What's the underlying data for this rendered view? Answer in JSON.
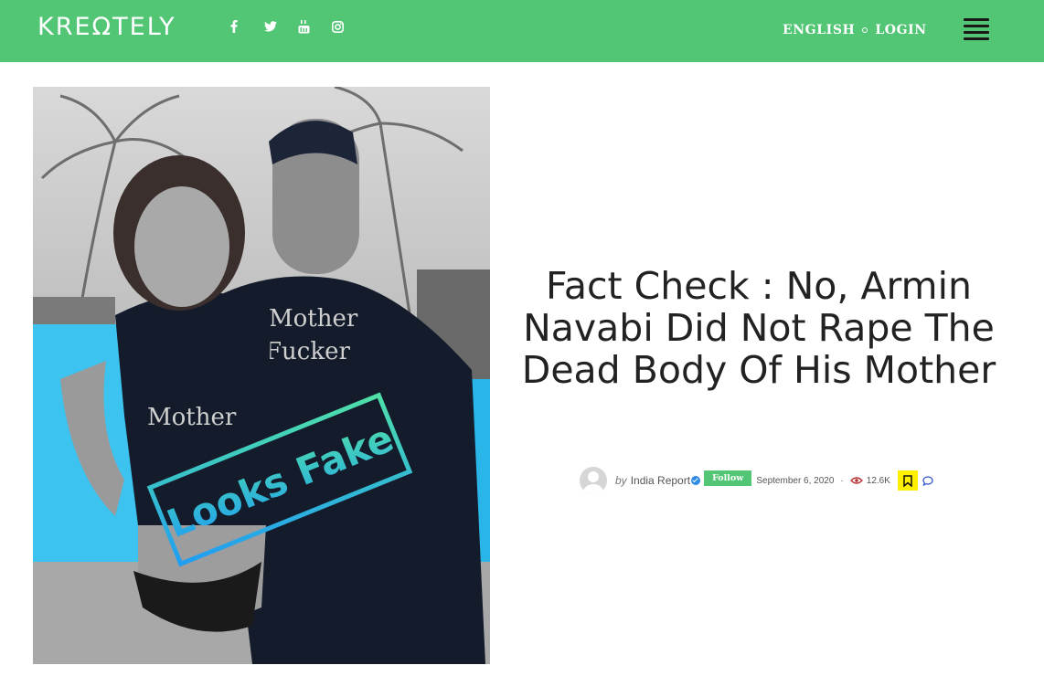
{
  "header": {
    "logo": "KREΩTELY",
    "social_icons": [
      "facebook-icon",
      "twitter-icon",
      "youtube-icon",
      "instagram-icon"
    ],
    "language_label": "ENGLISH",
    "login_label": "LOGIN",
    "menu_icon": "hamburger-menu-icon",
    "background_color": "#52c675"
  },
  "hero": {
    "left_shirt_text": "Mother",
    "right_shirt_line1": "Mother",
    "right_shirt_line2": "Fucker",
    "stamp_text": "Looks Fake"
  },
  "article": {
    "title": "Fact Check : No, Armin Navabi Did Not Rape The Dead Body Of His Mother",
    "by_label": "by",
    "author": "India Report",
    "follow_label": "Follow",
    "date": "September 6, 2020",
    "separator": "·",
    "views": "12.6K",
    "accent_yellow": "#ffef00"
  }
}
